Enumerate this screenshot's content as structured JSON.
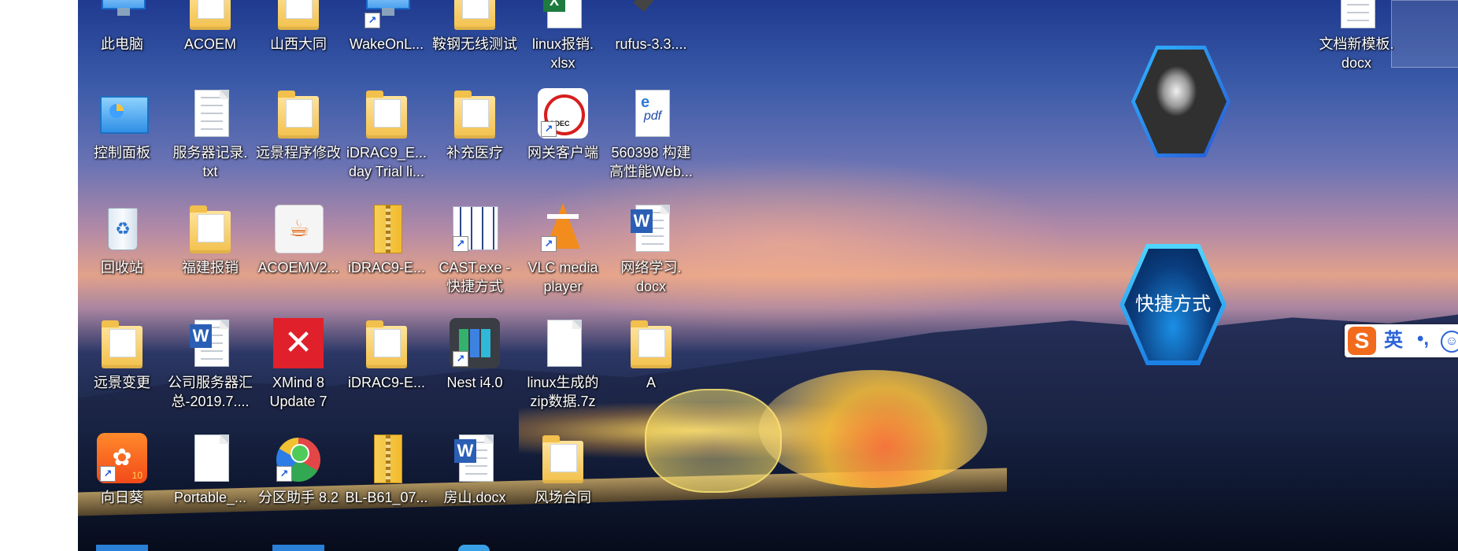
{
  "desktop_icons": {
    "r0c0": {
      "label": "此电脑",
      "icon": "this-pc-icon"
    },
    "r0c1": {
      "label": "ACOEM",
      "icon": "folder-icon"
    },
    "r0c2": {
      "label": "山西大同",
      "icon": "folder-icon"
    },
    "r0c3": {
      "label": "WakeOnL...",
      "icon": "wake-on-lan-icon"
    },
    "r0c4": {
      "label": "鞍钢无线测试",
      "icon": "folder-icon"
    },
    "r0c5": {
      "label": "linux报销.\nxlsx",
      "icon": "excel-file-icon"
    },
    "r0c6": {
      "label": "rufus-3.3....",
      "icon": "usb-drive-icon"
    },
    "r1c0": {
      "label": "控制面板",
      "icon": "control-panel-icon"
    },
    "r1c1": {
      "label": "服务器记录.\ntxt",
      "icon": "text-file-icon"
    },
    "r1c2": {
      "label": "远景程序修改",
      "icon": "folder-icon"
    },
    "r1c3": {
      "label": "iDRAC9_E...\nday Trial li...",
      "icon": "folder-icon"
    },
    "r1c4": {
      "label": "补充医疗",
      "icon": "folder-icon"
    },
    "r1c5": {
      "label": "网关客户端",
      "icon": "nodec-icon"
    },
    "r1c6": {
      "label": "560398 构建\n高性能Web...",
      "icon": "pdf-file-icon"
    },
    "r2c0": {
      "label": "回收站",
      "icon": "recycle-bin-icon"
    },
    "r2c1": {
      "label": "福建报销",
      "icon": "folder-icon"
    },
    "r2c2": {
      "label": "ACOEMV2...",
      "icon": "java-icon"
    },
    "r2c3": {
      "label": "iDRAC9-E...",
      "icon": "zip-folder-icon"
    },
    "r2c4": {
      "label": "CAST.exe -\n快捷方式",
      "icon": "cast-icon"
    },
    "r2c5": {
      "label": "VLC media\nplayer",
      "icon": "vlc-icon"
    },
    "r2c6": {
      "label": "网络学习.\ndocx",
      "icon": "word-file-icon"
    },
    "r3c0": {
      "label": "远景变更",
      "icon": "folder-icon"
    },
    "r3c1": {
      "label": "公司服务器汇\n总-2019.7....",
      "icon": "word-file-icon"
    },
    "r3c2": {
      "label": "XMind 8\nUpdate 7",
      "icon": "xmind-icon"
    },
    "r3c3": {
      "label": "iDRAC9-E...",
      "icon": "folder-icon"
    },
    "r3c4": {
      "label": "Nest i4.0",
      "icon": "nest-icon"
    },
    "r3c5": {
      "label": "linux生成的\nzip数据.7z",
      "icon": "blank-file-icon"
    },
    "r3c6": {
      "label": "A",
      "icon": "folder-icon"
    },
    "r4c0": {
      "label": "向日葵",
      "icon": "sunflower-icon"
    },
    "r4c1": {
      "label": "Portable_...",
      "icon": "blank-file-icon"
    },
    "r4c2": {
      "label": "分区助手 8.2",
      "icon": "partition-assistant-icon"
    },
    "r4c3": {
      "label": "BL-B61_07...",
      "icon": "zip-folder-icon"
    },
    "r4c4": {
      "label": "房山.docx",
      "icon": "word-file-icon"
    },
    "r4c5": {
      "label": "风场合同",
      "icon": "folder-icon"
    },
    "right0": {
      "label": "文档新模板.\ndocx",
      "icon": "word-file-icon"
    }
  },
  "widgets": {
    "quick_label": "快捷方式",
    "photo_icon": "profile-photo-hexagon"
  },
  "ime": {
    "logo": "S",
    "lang": "英",
    "punct": "•,",
    "emoji": "☺"
  },
  "colors": {
    "sky_top": "#1f3a8f",
    "sunset": "#e2a28a",
    "ime_orange": "#f26b1d",
    "hex_blue": "#1b7fe6"
  }
}
